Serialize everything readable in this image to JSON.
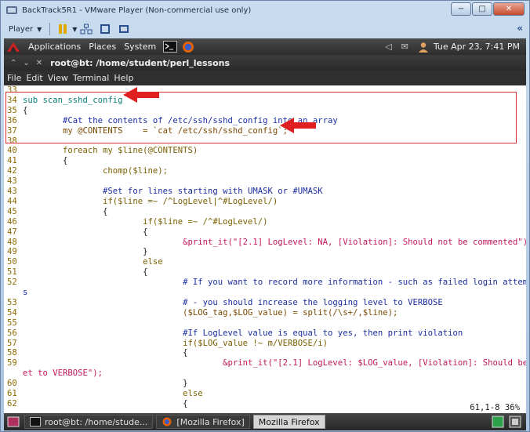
{
  "vm": {
    "title": "BackTrack5R1 - VMware Player (Non-commercial use only)",
    "player_label": "Player",
    "window_buttons": {
      "minimize": "−",
      "maximize": "□",
      "close": "✕"
    },
    "collapse_glyph": "«"
  },
  "gnome": {
    "menus": [
      "Applications",
      "Places",
      "System"
    ],
    "datetime": "Tue Apr 23,  7:41 PM"
  },
  "terminal": {
    "title": "root@bt: /home/student/perl_lessons",
    "menus": [
      "File",
      "Edit",
      "View",
      "Terminal",
      "Help"
    ],
    "status": "61,1-8          36%"
  },
  "code": [
    {
      "ln": "33",
      "text": ""
    },
    {
      "ln": "34",
      "text": "sub scan_sshd_config",
      "style": "fn"
    },
    {
      "ln": "35",
      "text": "{"
    },
    {
      "ln": "36",
      "text": "        #Cat the contents of /etc/ssh/sshd_config into an array",
      "style": "cmt"
    },
    {
      "ln": "37",
      "text": "        my @CONTENTS    = `cat /etc/ssh/sshd_config`;",
      "style": "var"
    },
    {
      "ln": "38",
      "text": ""
    },
    {
      "ln": "40",
      "text": "        foreach my $line(@CONTENTS)",
      "style": "kw"
    },
    {
      "ln": "41",
      "text": "        {"
    },
    {
      "ln": "42",
      "text": "                chomp($line);",
      "style": "kw"
    },
    {
      "ln": "43",
      "text": ""
    },
    {
      "ln": "43",
      "text": "                #Set for lines starting with UMASK or #UMASK",
      "style": "cmt"
    },
    {
      "ln": "44",
      "text": "                if($line =~ /^LogLevel|^#LogLevel/)",
      "style": "kw"
    },
    {
      "ln": "45",
      "text": "                {"
    },
    {
      "ln": "46",
      "text": "                        if($line =~ /^#LogLevel/)",
      "style": "kw"
    },
    {
      "ln": "47",
      "text": "                        {"
    },
    {
      "ln": "48",
      "text": "                                &print_it(\"[2.1] LogLevel: NA, [Violation]: Should not be commented\");",
      "style": "str"
    },
    {
      "ln": "49",
      "text": "                        }"
    },
    {
      "ln": "50",
      "text": "                        else",
      "style": "kw"
    },
    {
      "ln": "51",
      "text": "                        {"
    },
    {
      "ln": "52",
      "text": "                                # If you want to record more information - such as failed login attempt",
      "style": "cmt"
    },
    {
      "ln": "",
      "text": "s",
      "style": "cmt"
    },
    {
      "ln": "53",
      "text": "                                # - you should increase the logging level to VERBOSE",
      "style": "cmt"
    },
    {
      "ln": "54",
      "text": "                                ($LOG_tag,$LOG_value) = split(/\\s+/,$line);",
      "style": "var"
    },
    {
      "ln": "55",
      "text": ""
    },
    {
      "ln": "56",
      "text": "                                #If LogLevel value is equal to yes, then print violation",
      "style": "cmt"
    },
    {
      "ln": "57",
      "text": "                                if($LOG_value !~ m/VERBOSE/i)",
      "style": "kw"
    },
    {
      "ln": "58",
      "text": "                                {"
    },
    {
      "ln": "59",
      "text": "                                        &print_it(\"[2.1] LogLevel: $LOG_value, [Violation]: Should be s",
      "style": "str"
    },
    {
      "ln": "",
      "text": "et to VERBOSE\");",
      "style": "str"
    },
    {
      "ln": "60",
      "text": "                                }"
    },
    {
      "ln": "61",
      "text": "                                else",
      "style": "kw"
    },
    {
      "ln": "62",
      "text": "                                {"
    }
  ],
  "taskbar": {
    "items": [
      "root@bt: /home/stude...",
      "[Mozilla Firefox]",
      "Mozilla Firefox"
    ]
  },
  "colors": {
    "highlight": "#e03030",
    "arrow": "#e02020"
  }
}
